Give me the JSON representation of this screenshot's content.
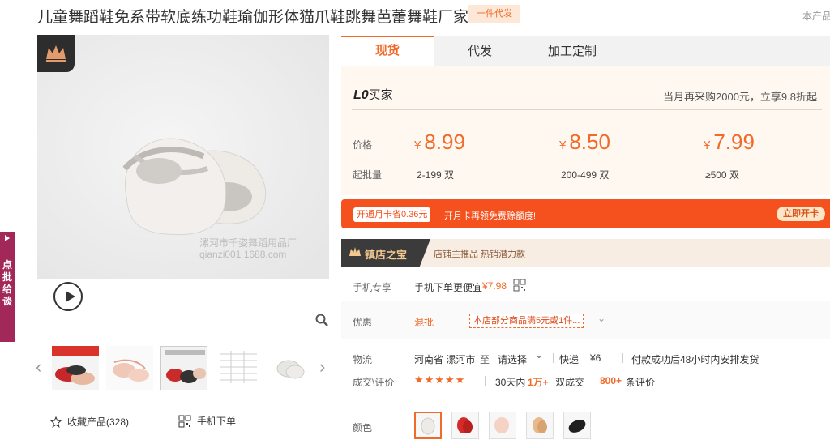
{
  "title": "儿童舞蹈鞋免系带软底练功鞋瑜伽形体猫爪鞋跳舞芭蕾舞鞋厂家批发",
  "dropship_badge": "一件代发",
  "top_right": "本产品",
  "gallery": {
    "watermark": "漯河市千姿舞蹈用品厂 qianzi001 1688.com"
  },
  "actions": {
    "favorite": "收藏产品(328)",
    "mobile_order": "手机下单"
  },
  "side_tab": "点批给谈",
  "tabs": [
    {
      "label": "现货",
      "active": true
    },
    {
      "label": "代发",
      "active": false
    },
    {
      "label": "加工定制",
      "active": false
    }
  ],
  "buyer_level": {
    "badge": "L0",
    "label": "买家"
  },
  "monthly_promo": "当月再采购2000元，立享9.8折起",
  "price_label": "价格",
  "moq_label": "起批量",
  "currency": "¥",
  "tiers": [
    {
      "price": "8.99",
      "qty": "2-199 双"
    },
    {
      "price": "8.50",
      "qty": "200-499 双"
    },
    {
      "price": "7.99",
      "qty": "≥500 双"
    }
  ],
  "card_bar": {
    "pill": "开通月卡省0.36元",
    "text": "开月卡再领免费赊额度!",
    "button": "立即开卡"
  },
  "treasure": {
    "title": "镇店之宝",
    "text": "店铺主推品  热销潜力款"
  },
  "mobile_exclusive": {
    "label": "手机专享",
    "text": "手机下单更便宜",
    "price": "¥7.98"
  },
  "discount": {
    "label": "优惠",
    "type": "混批",
    "coupon": "本店部分商品满5元或1件..."
  },
  "logistics": {
    "label": "物流",
    "origin": "河南省 漯河市",
    "to": "至",
    "dest": "请选择",
    "express": "快递",
    "fee": "¥6",
    "ship_note": "付款成功后48小时内安排发货"
  },
  "reviews": {
    "label": "成交\\评价",
    "stars": "★★★★★",
    "days": "30天内",
    "sold": "1万+",
    "sold_unit": "双成交",
    "count": "800+",
    "count_unit": "条评价"
  },
  "color_label": "颜色",
  "colors": {
    "swatch_count": 5,
    "selected_index": 0
  },
  "accent_color": "#f06a2a",
  "card_bar_color": "#f4511e"
}
